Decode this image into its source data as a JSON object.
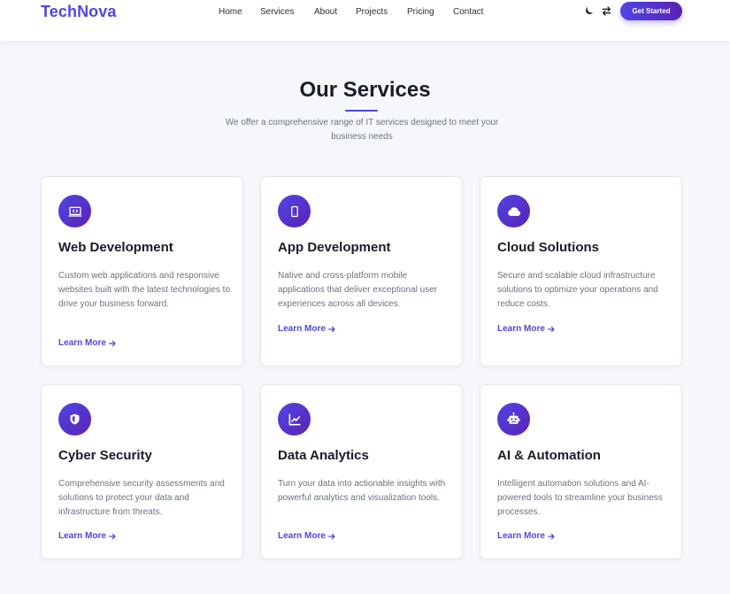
{
  "header": {
    "brand": "TechNova",
    "nav": [
      "Home",
      "Services",
      "About",
      "Projects",
      "Pricing",
      "Contact"
    ],
    "theme_toggle_icon": "moon-icon",
    "swap_icon": "arrows-swap-icon",
    "cta_label": "Get Started"
  },
  "services": {
    "title": "Our Services",
    "subtitle": "We offer a comprehensive range of IT services designed to meet your business needs",
    "accent_color": "#4f46e5",
    "cards": [
      {
        "icon": "laptop-code-icon",
        "title": "Web Development",
        "description": "Custom web applications and responsive websites built with the latest technologies to drive your business forward.",
        "link": "Learn More"
      },
      {
        "icon": "mobile-phone-icon",
        "title": "App Development",
        "description": "Native and cross-platform mobile applications that deliver exceptional user experiences across all devices.",
        "link": "Learn More"
      },
      {
        "icon": "cloud-icon",
        "title": "Cloud Solutions",
        "description": "Secure and scalable cloud infrastructure solutions to optimize your operations and reduce costs.",
        "link": "Learn More"
      },
      {
        "icon": "shield-icon",
        "title": "Cyber Security",
        "description": "Comprehensive security assessments and solutions to protect your data and infrastructure from threats.",
        "link": "Learn More"
      },
      {
        "icon": "chart-line-icon",
        "title": "Data Analytics",
        "description": "Turn your data into actionable insights with powerful analytics and visualization tools.",
        "link": "Learn More"
      },
      {
        "icon": "robot-icon",
        "title": "AI & Automation",
        "description": "Intelligent automation solutions and AI-powered tools to streamline your business processes.",
        "link": "Learn More"
      }
    ]
  }
}
